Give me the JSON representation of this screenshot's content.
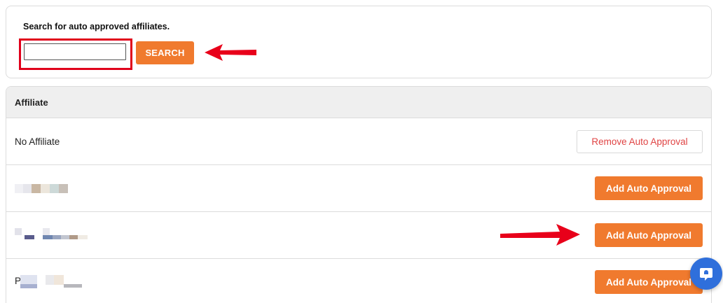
{
  "search": {
    "label": "Search for auto approved affiliates.",
    "input_value": "",
    "button_label": "SEARCH"
  },
  "table": {
    "header": "Affiliate",
    "rows": [
      {
        "name": "No Affiliate",
        "action": "Remove Auto Approval"
      },
      {
        "name": "",
        "action": "Add Auto Approval"
      },
      {
        "name": "",
        "action": "Add Auto Approval"
      },
      {
        "name": "P",
        "action": "Add Auto Approval"
      }
    ]
  },
  "colors": {
    "accent": "#f07a2e",
    "remove_text": "#e04444",
    "annotation_red": "#e0001b",
    "chat_blue": "#2f6fdb"
  },
  "icons": {
    "chat": "chat-bubble-icon",
    "annotation": "red-arrow-icon"
  }
}
